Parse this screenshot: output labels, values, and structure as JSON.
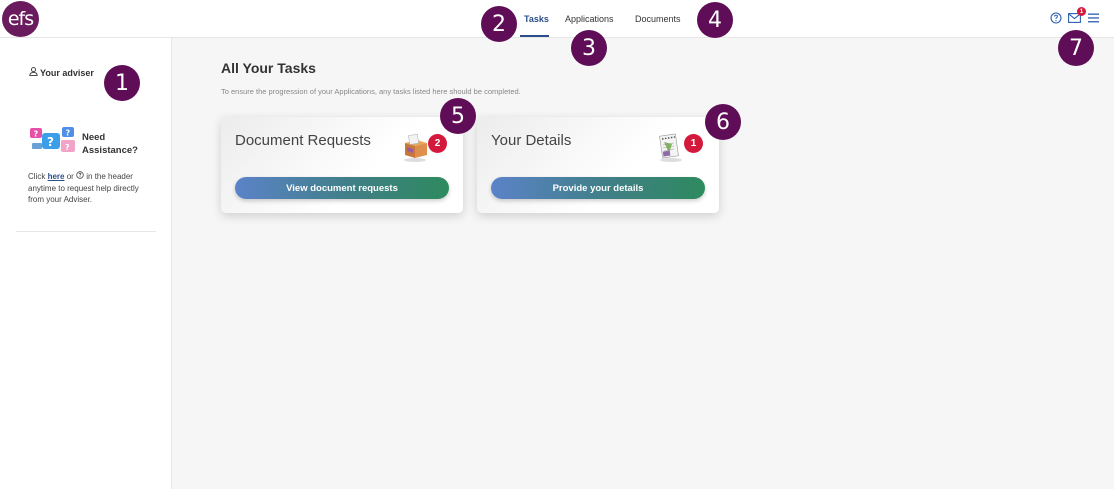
{
  "header": {
    "logo_text": "efs",
    "nav": [
      {
        "label": "Tasks",
        "active": true
      },
      {
        "label": "Applications",
        "active": false
      },
      {
        "label": "Documents",
        "active": false
      }
    ],
    "mail_badge": "1",
    "icons": [
      "help-icon",
      "mail-icon",
      "menu-icon"
    ],
    "accent_color": "#2b4f8a"
  },
  "sidebar": {
    "adviser_label": "Your adviser",
    "assist_title_line1": "Need",
    "assist_title_line2": "Assistance?",
    "assist_text_pre": "Click ",
    "assist_link": "here",
    "assist_text_mid": " or ",
    "assist_text_post": " in the header anytime to request help directly from your Adviser."
  },
  "main": {
    "title": "All Your Tasks",
    "subtitle": "To ensure the progression of your Applications, any tasks listed here should be completed.",
    "cards": [
      {
        "title": "Document Requests",
        "badge": "2",
        "button": "View document requests",
        "icon": "documents-box-icon"
      },
      {
        "title": "Your Details",
        "badge": "1",
        "button": "Provide your details",
        "icon": "notepad-icon"
      }
    ]
  },
  "markers": [
    "1",
    "2",
    "3",
    "4",
    "5",
    "6",
    "7"
  ],
  "colors": {
    "badge": "#d41a3c",
    "marker": "#5e0d56",
    "logo": "#6a1b5d"
  }
}
